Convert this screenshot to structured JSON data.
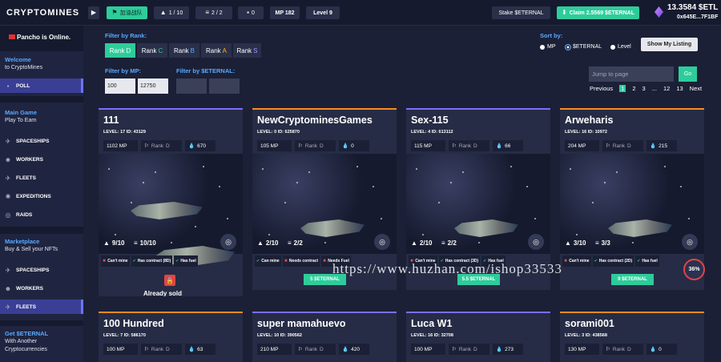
{
  "topbar": {
    "logo": "CRYPTOMINES",
    "chip_guild": "加油战队",
    "chip_fleets": "1 / 10",
    "chip_rank": "2 / 2",
    "chip_count": "0",
    "mp": "MP 182",
    "level": "Level 9",
    "stake_label": "Stake  $ETERNAL",
    "claim_label": "Claim 2.5569 $ETERNAL",
    "balance": "13.3584 $ETL",
    "address": "0x645E...7F1BF",
    "accent": "#2ecc9b"
  },
  "sidebar": {
    "online": "Pancho is Online.",
    "welcome_h": "Welcome",
    "welcome_s": "to CryptoMines",
    "poll": "POLL",
    "main_h": "Main Game",
    "main_s": "Play To Earn",
    "items": [
      "SPACESHIPS",
      "WORKERS",
      "FLEETS",
      "EXPEDITIONS",
      "RAIDS"
    ],
    "market_h": "Marketplace",
    "market_s": "Buy & Sell your NFTs",
    "market_items": [
      "SPACESHIPS",
      "WORKERS",
      "FLEETS"
    ],
    "get_h": "Get $ETERNAL",
    "get_s1": "With Another",
    "get_s2": "Cryptocurrencies"
  },
  "filters": {
    "rank_label": "Filter by Rank:",
    "ranks": [
      {
        "t": "Rank",
        "l": "D"
      },
      {
        "t": "Rank",
        "l": "C"
      },
      {
        "t": "Rank",
        "l": "B"
      },
      {
        "t": "Rank",
        "l": "A"
      },
      {
        "t": "Rank",
        "l": "S"
      }
    ],
    "mp_label": "Filter by MP:",
    "mp_min": "100",
    "mp_max": "12750",
    "eternal_label": "Filter by $ETERNAL:",
    "sort_label": "Sort by:",
    "sort_opts": [
      "MP",
      "$ETERNAL",
      "Level"
    ],
    "show_listing": "Show My Listing",
    "jump_placeholder": "Jump to page",
    "go": "Go",
    "pager": [
      "Previous",
      "1",
      "2",
      "3",
      "...",
      "12",
      "13",
      "Next"
    ]
  },
  "cards": [
    {
      "title": "111",
      "meta": "LEVEL: 17   ID: 43129",
      "mp": "1102 MP",
      "rank": "Rank",
      "rank_l": "D",
      "fuel": "670",
      "ships": "9/10",
      "layers": "10/10",
      "c1": "Can't mine",
      "c2": "Has contract (8D)",
      "c3": "Has fuel",
      "sold": "Already sold"
    },
    {
      "title": "NewCryptominesGames",
      "meta": "LEVEL: 0   ID: 625870",
      "mp": "105 MP",
      "rank": "Rank",
      "rank_l": "D",
      "fuel": "0",
      "ships": "2/10",
      "layers": "2/2",
      "c1": "Can mine",
      "c2": "Needs contract",
      "c3": "Needs Fuel",
      "price": "5 $ETERNAL"
    },
    {
      "title": "Sex-115",
      "meta": "LEVEL: 4   ID: 613112",
      "mp": "115 MP",
      "rank": "Rank",
      "rank_l": "D",
      "fuel": "66",
      "ships": "2/10",
      "layers": "2/2",
      "c1": "Can't mine",
      "c2": "Has contract (3D)",
      "c3": "Has fuel",
      "price": "5.5 $ETERNAL"
    },
    {
      "title": "Arweharis",
      "meta": "LEVEL: 16   ID: 10972",
      "mp": "204 MP",
      "rank": "Rank",
      "rank_l": "D",
      "fuel": "215",
      "ships": "3/10",
      "layers": "3/3",
      "c1": "Can't mine",
      "c2": "Has contract (2D)",
      "c3": "Has fuel",
      "price": "9 $ETERNAL"
    },
    {
      "title": "100 Hundred",
      "meta": "LEVEL: 7   ID: 586170",
      "mp": "100 MP",
      "rank": "Rank",
      "rank_l": "D",
      "fuel": "63"
    },
    {
      "title": "super mamahuevo",
      "meta": "LEVEL: 10   ID: 390562",
      "mp": "210 MP",
      "rank": "Rank",
      "rank_l": "D",
      "fuel": "420"
    },
    {
      "title": "Luca W1",
      "meta": "LEVEL: 16   ID: 32708",
      "mp": "100 MP",
      "rank": "Rank",
      "rank_l": "D",
      "fuel": "273"
    },
    {
      "title": "sorami001",
      "meta": "LEVEL: 3   ID: 438568",
      "mp": "130 MP",
      "rank": "Rank",
      "rank_l": "D",
      "fuel": "0"
    }
  ],
  "overlay": {
    "badge": "36%",
    "watermark": "https://www.huzhan.com/ishop33533"
  }
}
